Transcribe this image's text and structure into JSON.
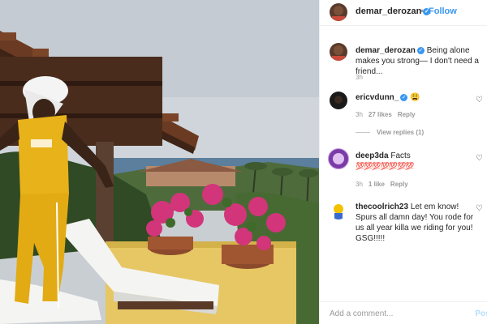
{
  "post": {
    "author": "demar_derozan",
    "follow_label": "Follow",
    "separator": "•",
    "verified_mark": "✓",
    "photo_alt": "Man in yellow tracksuit with towel on head on a resort terrace with ocean view"
  },
  "comments": [
    {
      "user": "demar_derozan",
      "verified": true,
      "text": "Being alone makes you strong— I don't need a friend...",
      "time": "3h",
      "likes": "",
      "reply": "",
      "avatar_color": "#5a3a2a"
    },
    {
      "user": "ericvdunn_",
      "verified": true,
      "text": "😩",
      "time": "3h",
      "likes": "27 likes",
      "reply": "Reply",
      "view_replies": "View replies (1)",
      "avatar_color": "#1a1a1a"
    },
    {
      "user": "deep3da",
      "verified": false,
      "text": "Facts",
      "emoji_row": "💯💯💯💯💯💯💯",
      "time": "3h",
      "likes": "1 like",
      "reply": "Reply",
      "avatar_color": "#7a3aa8"
    },
    {
      "user": "thecoolrich23",
      "verified": false,
      "text": "Let em know! Spurs all damn day! You rode for us all year killa we riding for you! GSG!!!!!",
      "time": "",
      "likes": "",
      "reply": "",
      "avatar_color": "#f2c200"
    }
  ],
  "footer": {
    "placeholder": "Add a comment...",
    "post_label": "Post"
  },
  "colors": {
    "accent": "#3897f0",
    "jersey": "#e8b21a"
  }
}
